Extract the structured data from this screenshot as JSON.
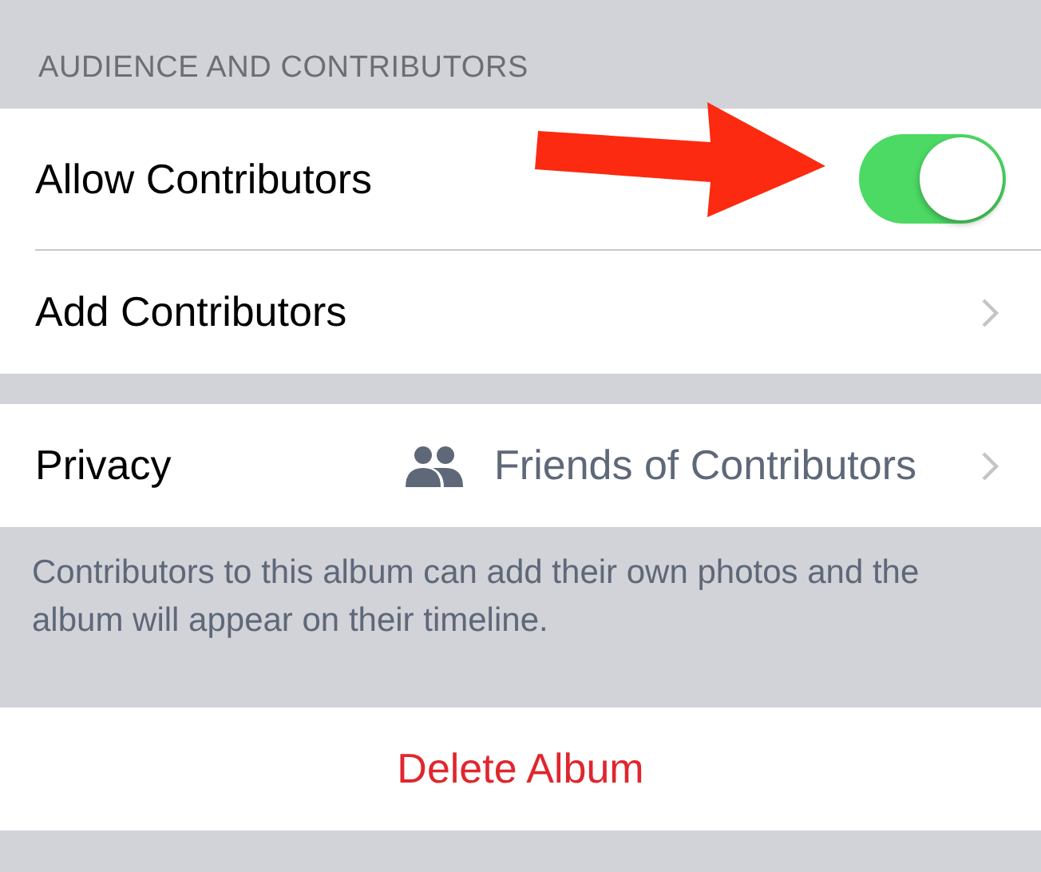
{
  "section_header": "AUDIENCE AND CONTRIBUTORS",
  "group_1": [
    {
      "kind": "toggle",
      "label": "Allow Contributors",
      "on": true
    },
    {
      "kind": "disclosure",
      "label": "Add Contributors"
    }
  ],
  "group_2": [
    {
      "kind": "value",
      "label": "Privacy",
      "value": "Friends of Contributors"
    }
  ],
  "footer": "Contributors to this album can add their own photos and the album will appear on their timeline.",
  "delete_button": "Delete Album"
}
